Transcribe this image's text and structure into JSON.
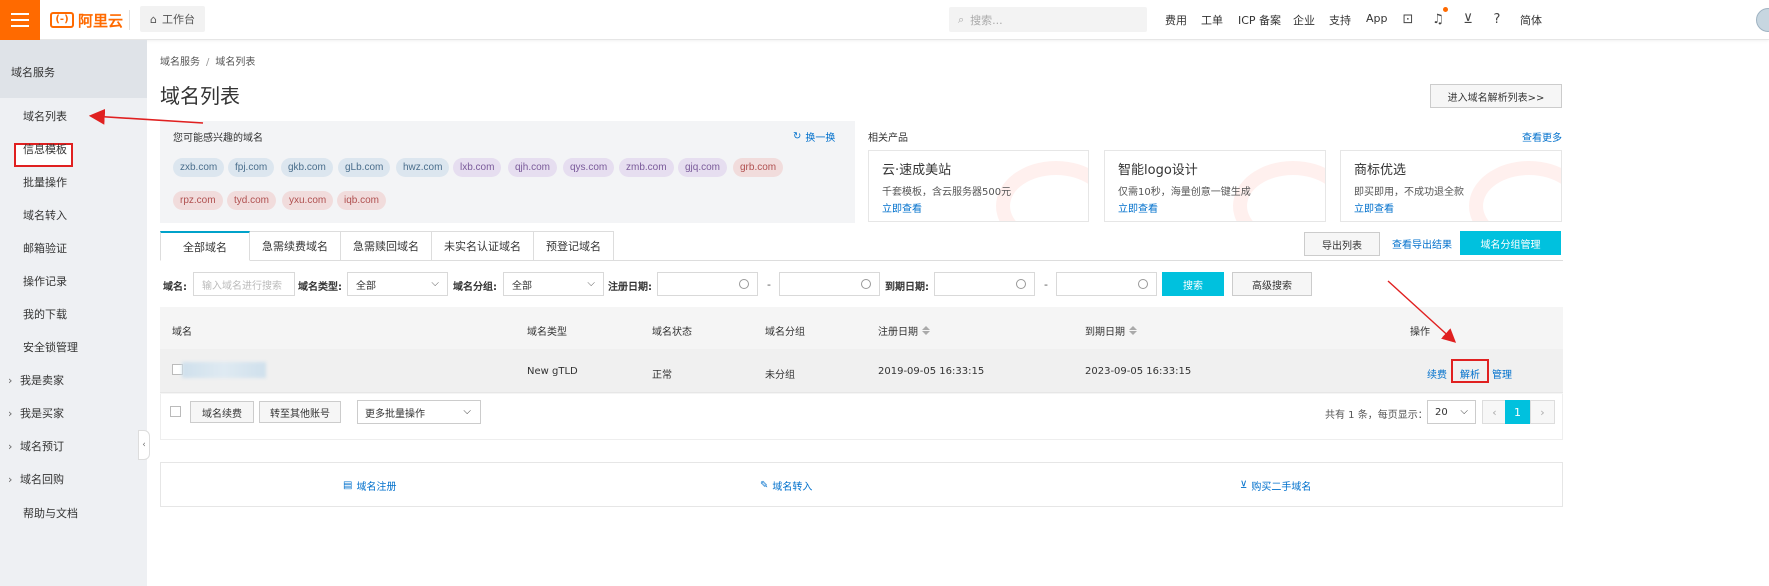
{
  "topbar": {
    "logo_text": "阿里云",
    "logo_mark": "(-)",
    "workbench_label": "工作台",
    "search_placeholder": "搜索...",
    "nav": [
      "费用",
      "工单",
      "ICP 备案",
      "企业",
      "支持",
      "App"
    ],
    "lang_label": "简体",
    "brand_color": "#ff6a00"
  },
  "sidebar": {
    "title": "域名服务",
    "items": [
      "域名列表",
      "信息模板",
      "批量操作",
      "域名转入",
      "邮箱验证",
      "操作记录",
      "我的下载",
      "安全锁管理"
    ],
    "groups": [
      "我是卖家",
      "我是买家",
      "域名预订",
      "域名回购"
    ],
    "footer_item": "帮助与文档",
    "active_item": "域名列表"
  },
  "breadcrumb": [
    "域名服务",
    "域名列表"
  ],
  "page_title": "域名列表",
  "dns_list_button": "进入域名解析列表>>",
  "suggest": {
    "title": "您可能感兴趣的域名",
    "refresh_label": "换一换",
    "chips_row1": [
      "zxb.com",
      "fpj.com",
      "gkb.com",
      "gLb.com",
      "hwz.com",
      "lxb.com",
      "qjh.com",
      "qys.com",
      "zmb.com",
      "gjq.com",
      "grb.com"
    ],
    "chips_row2": [
      "rpz.com",
      "tyd.com",
      "yxu.com",
      "iqb.com"
    ]
  },
  "related": {
    "title": "相关产品",
    "more_label": "查看更多",
    "products": [
      {
        "name": "云·速成美站",
        "desc": "千套模板，含云服务器500元",
        "link": "立即查看"
      },
      {
        "name": "智能logo设计",
        "desc": "仅需10秒，海量创意一键生成",
        "link": "立即查看"
      },
      {
        "name": "商标优选",
        "desc": "即买即用，不成功退全款",
        "link": "立即查看"
      }
    ]
  },
  "tabs": [
    "全部域名",
    "急需续费域名",
    "急需赎回域名",
    "未实名认证域名",
    "预登记域名"
  ],
  "actions": {
    "export_list": "导出列表",
    "export_result": "查看导出结果",
    "group_mgmt": "域名分组管理"
  },
  "filters": {
    "domain_label": "域名:",
    "domain_placeholder": "输入域名进行搜索",
    "type_label": "域名类型:",
    "type_value": "全部",
    "group_label": "域名分组:",
    "group_value": "全部",
    "reg_date_label": "注册日期:",
    "exp_date_label": "到期日期:",
    "dash": "-",
    "search_button": "搜索",
    "advanced_button": "高级搜索"
  },
  "table": {
    "headers": [
      "域名",
      "域名类型",
      "域名状态",
      "域名分组",
      "注册日期",
      "到期日期",
      "操作"
    ],
    "rows": [
      {
        "type": "New gTLD",
        "status": "正常",
        "group": "未分组",
        "reg_date": "2019-09-05 16:33:15",
        "exp_date": "2023-09-05 16:33:15",
        "ops": [
          "续费",
          "解析",
          "管理"
        ]
      }
    ]
  },
  "footer": {
    "renew_button": "域名续费",
    "transfer_button": "转至其他账号",
    "batch_select": "更多批量操作",
    "total_text": "共有 1 条，每页显示：",
    "page_size": "20",
    "current_page": "1",
    "prev": "‹",
    "next": "›"
  },
  "bottom_links": [
    "域名注册",
    "域名转入",
    "购买二手域名"
  ],
  "colors": {
    "accent": "#00c1de",
    "link": "#0070cc",
    "highlight": "#e02020"
  }
}
